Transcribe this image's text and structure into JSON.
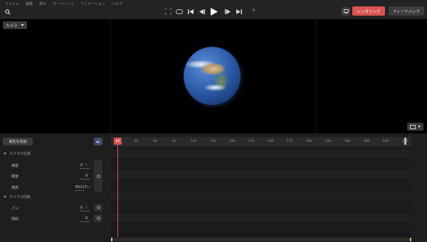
{
  "menus": [
    "ファイル",
    "編集",
    "表示",
    "オーバーレイ",
    "アニメーション",
    "ヘルプ"
  ],
  "toolbar": {
    "frame": "0",
    "render_label": "レンダリング",
    "feedback_label": "フィードバック"
  },
  "viewport": {
    "camera_label": "カメラ"
  },
  "timeline": {
    "add_attribute_label": "属性を追加",
    "current_frame": "00",
    "ticks": [
      "30",
      "60",
      "90",
      "120",
      "150",
      "180",
      "210",
      "240",
      "270",
      "300",
      "330",
      "360",
      "390",
      "420",
      "450"
    ]
  },
  "properties": {
    "camera_position": {
      "title": "カメラの位置",
      "latitude": {
        "label": "緯度",
        "value": "0",
        "unit": "0"
      },
      "longitude": {
        "label": "経度",
        "value": "0"
      },
      "altitude": {
        "label": "標高",
        "value": "65117",
        "unit": "km"
      }
    },
    "camera_rotation": {
      "title": "カメラの回転",
      "pan": {
        "label": "パン",
        "value": "0",
        "unit": "0"
      },
      "tilt": {
        "label": "傾斜",
        "value": "0"
      }
    }
  },
  "colors": {
    "accent_red": "#d9534f",
    "panel_bg": "#1e1e1f",
    "viewport_bg": "#000000"
  }
}
